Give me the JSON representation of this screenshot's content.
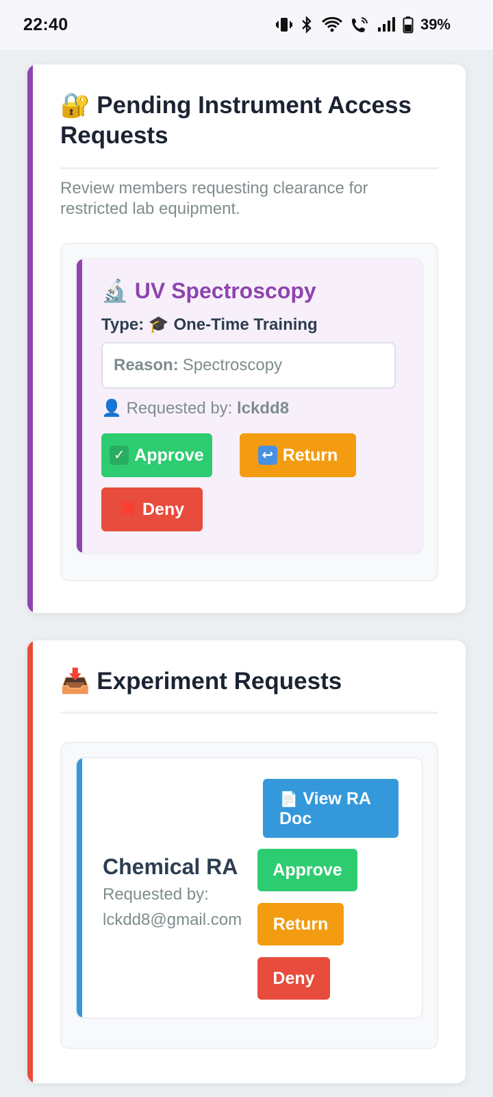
{
  "status_bar": {
    "time": "22:40",
    "battery": "39%",
    "icons": [
      "vibrate-icon",
      "bluetooth-icon",
      "wifi-icon",
      "wifi-calling-icon",
      "signal-icon",
      "battery-icon"
    ]
  },
  "instrument_card": {
    "title": "🔐 Pending Instrument Access Requests",
    "subtitle": "Review members requesting clearance for restricted lab equipment.",
    "accent": "#8e44ad",
    "request": {
      "instrument": "🔬 UV Spectroscopy",
      "type_label": "Type:",
      "type_value": "🎓 One-Time Training",
      "reason_label": "Reason:",
      "reason_value": "Spectroscopy",
      "requested_by_label": "Requested by:",
      "requested_by_value": "lckdd8",
      "approve_label": "Approve",
      "return_label": "Return",
      "deny_label": "Deny"
    }
  },
  "experiment_card": {
    "title": "📥 Experiment Requests",
    "accent": "#e74c3c",
    "request": {
      "name": "Chemical RA",
      "requested_by": "Requested by: lckdd8@gmail.com",
      "view_doc_label": "View RA Doc",
      "approve_label": "Approve",
      "return_label": "Return",
      "deny_label": "Deny"
    }
  },
  "colors": {
    "green": "#2ecc71",
    "orange": "#f39c12",
    "red": "#e74c3c",
    "blue": "#3498db",
    "purple": "#8e44ad"
  }
}
